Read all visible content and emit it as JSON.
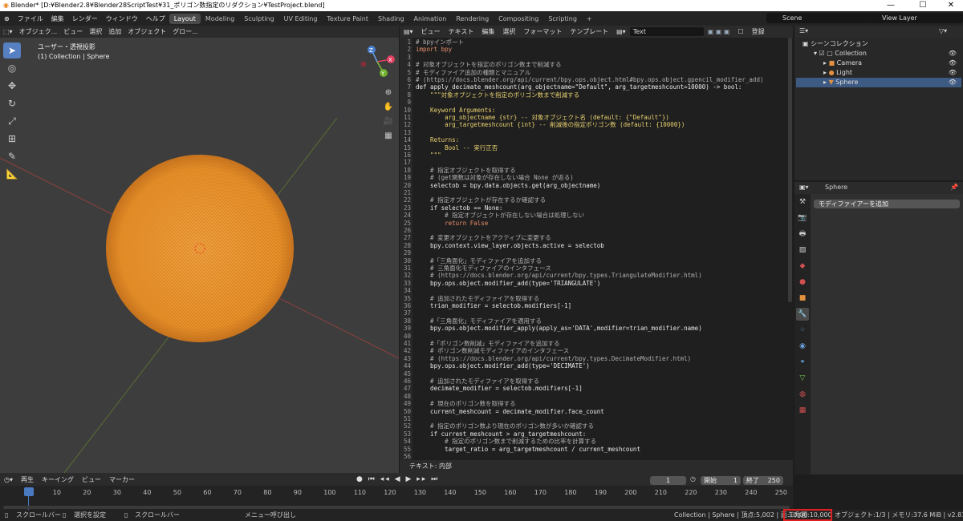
{
  "window": {
    "title": "Blender* [D:¥Blender2.8¥Blender28ScriptTest¥31_ポリゴン数指定のリダクション¥TestProject.blend]",
    "min": "—",
    "max": "☐",
    "close": "✕"
  },
  "menubar": {
    "menus": [
      "ファイル",
      "編集",
      "レンダー",
      "ウィンドウ",
      "ヘルプ"
    ],
    "workspaces": [
      "Layout",
      "Modeling",
      "Sculpting",
      "UV Editing",
      "Texture Paint",
      "Shading",
      "Animation",
      "Rendering",
      "Compositing",
      "Scripting"
    ],
    "active_workspace": "Layout",
    "add_tab": "+",
    "scene": "Scene",
    "view_layer": "View Layer"
  },
  "viewport": {
    "header": [
      "オブジェク...",
      "ビュー",
      "選択",
      "追加",
      "オブジェクト",
      "グロー..."
    ],
    "view_label": "ユーザー・透視投影",
    "collection_label": "(1) Collection | Sphere",
    "gizmo_x": "X",
    "gizmo_y": "Y",
    "gizmo_z": "Z"
  },
  "text_editor": {
    "header": [
      "ビュー",
      "テキスト",
      "編集",
      "選択",
      "フォーマット",
      "テンプレート"
    ],
    "text_name": "Text",
    "register_label": "登録",
    "footer": "テキスト: 内部"
  },
  "code_lines": [
    {
      "n": "1",
      "t": "# bpyインポート",
      "c": "c"
    },
    {
      "n": "2",
      "t": "import bpy",
      "c": "k"
    },
    {
      "n": "3",
      "t": "",
      "c": "t"
    },
    {
      "n": "4",
      "t": "# 対象オブジェクトを指定のポリゴン数まで削減する",
      "c": "c"
    },
    {
      "n": "5",
      "t": "# モディファイア追加の種類とマニュアル",
      "c": "c"
    },
    {
      "n": "6",
      "t": "# (https://docs.blender.org/api/current/bpy.ops.object.html#bpy.ops.object.gpencil_modifier_add)",
      "c": "c"
    },
    {
      "n": "7",
      "t": "def apply_decimate_meshcount(arg_objectname=\"Default\", arg_targetmeshcount=10000) -> bool:",
      "c": "t"
    },
    {
      "n": "8",
      "t": "    \"\"\"対象オブジェクトを指定のポリゴン数まで削減する",
      "c": "d"
    },
    {
      "n": "9",
      "t": "",
      "c": "t"
    },
    {
      "n": "10",
      "t": "    Keyword Arguments:",
      "c": "d"
    },
    {
      "n": "11",
      "t": "        arg_objectname {str} -- 対象オブジェクト名 (default: {\"Default\"})",
      "c": "d"
    },
    {
      "n": "12",
      "t": "        arg_targetmeshcount {int} -- 削減後の指定ポリゴン数 (default: {10000})",
      "c": "d"
    },
    {
      "n": "13",
      "t": "",
      "c": "t"
    },
    {
      "n": "14",
      "t": "    Returns:",
      "c": "d"
    },
    {
      "n": "15",
      "t": "        Bool -- 実行正否",
      "c": "d"
    },
    {
      "n": "16",
      "t": "    \"\"\"",
      "c": "d"
    },
    {
      "n": "17",
      "t": "",
      "c": "t"
    },
    {
      "n": "18",
      "t": "    # 指定オブジェクトを取得する",
      "c": "c"
    },
    {
      "n": "19",
      "t": "    # (get関数は対象が存在しない場合 None が返る)",
      "c": "c"
    },
    {
      "n": "20",
      "t": "    selectob = bpy.data.objects.get(arg_objectname)",
      "c": "t"
    },
    {
      "n": "21",
      "t": "",
      "c": "t"
    },
    {
      "n": "22",
      "t": "    # 指定オブジェクトが存在するか確認する",
      "c": "c"
    },
    {
      "n": "23",
      "t": "    if selectob == None:",
      "c": "t"
    },
    {
      "n": "24",
      "t": "        # 指定オブジェクトが存在しない場合は処理しない",
      "c": "c"
    },
    {
      "n": "25",
      "t": "        return False",
      "c": "k"
    },
    {
      "n": "26",
      "t": "",
      "c": "t"
    },
    {
      "n": "27",
      "t": "    # 変更オブジェクトをアクティブに変更する",
      "c": "c"
    },
    {
      "n": "28",
      "t": "    bpy.context.view_layer.objects.active = selectob",
      "c": "t"
    },
    {
      "n": "29",
      "t": "",
      "c": "t"
    },
    {
      "n": "30",
      "t": "    #「三角面化」モディファイアを追加する",
      "c": "c"
    },
    {
      "n": "31",
      "t": "    # 三角面化モディファイアのインタフェース",
      "c": "c"
    },
    {
      "n": "32",
      "t": "    # (https://docs.blender.org/api/current/bpy.types.TriangulateModifier.html)",
      "c": "c"
    },
    {
      "n": "33",
      "t": "    bpy.ops.object.modifier_add(type='TRIANGULATE')",
      "c": "t"
    },
    {
      "n": "34",
      "t": "",
      "c": "t"
    },
    {
      "n": "35",
      "t": "    # 追加されたモディファイアを取得する",
      "c": "c"
    },
    {
      "n": "36",
      "t": "    trian_modifier = selectob.modifiers[-1]",
      "c": "t"
    },
    {
      "n": "37",
      "t": "",
      "c": "t"
    },
    {
      "n": "38",
      "t": "    #「三角面化」モディファイアを適用する",
      "c": "c"
    },
    {
      "n": "39",
      "t": "    bpy.ops.object.modifier_apply(apply_as='DATA',modifier=trian_modifier.name)",
      "c": "t"
    },
    {
      "n": "40",
      "t": "",
      "c": "t"
    },
    {
      "n": "41",
      "t": "    #「ポリゴン数削減」モディファイアを追加する",
      "c": "c"
    },
    {
      "n": "42",
      "t": "    # ポリゴン数削減モディファイアのインタフェース",
      "c": "c"
    },
    {
      "n": "43",
      "t": "    # (https://docs.blender.org/api/current/bpy.types.DecimateModifier.html)",
      "c": "c"
    },
    {
      "n": "44",
      "t": "    bpy.ops.object.modifier_add(type='DECIMATE')",
      "c": "t"
    },
    {
      "n": "45",
      "t": "",
      "c": "t"
    },
    {
      "n": "46",
      "t": "    # 追加されたモディファイアを取得する",
      "c": "c"
    },
    {
      "n": "47",
      "t": "    decimate_modifier = selectob.modifiers[-1]",
      "c": "t"
    },
    {
      "n": "48",
      "t": "",
      "c": "t"
    },
    {
      "n": "49",
      "t": "    # 現在のポリゴン数を取得する",
      "c": "c"
    },
    {
      "n": "50",
      "t": "    current_meshcount = decimate_modifier.face_count",
      "c": "t"
    },
    {
      "n": "51",
      "t": "",
      "c": "t"
    },
    {
      "n": "52",
      "t": "    # 指定のポリゴン数より現在のポリゴン数が多いか確認する",
      "c": "c"
    },
    {
      "n": "53",
      "t": "    if current_meshcount > arg_targetmeshcount:",
      "c": "t"
    },
    {
      "n": "54",
      "t": "        # 指定のポリゴン数まで削減するための比率を計算する",
      "c": "c"
    },
    {
      "n": "55",
      "t": "        target_ratio = arg_targetmeshcount / current_meshcount",
      "c": "t"
    },
    {
      "n": "56",
      "t": "",
      "c": "t"
    }
  ],
  "outliner": {
    "root": "シーンコレクション",
    "items": [
      {
        "label": "Collection",
        "icon": "collection-icon"
      },
      {
        "label": "Camera",
        "icon": "camera-icon"
      },
      {
        "label": "Light",
        "icon": "light-icon"
      },
      {
        "label": "Sphere",
        "icon": "mesh-icon"
      }
    ]
  },
  "properties": {
    "object_name": "Sphere",
    "add_modifier": "モディファイアーを追加"
  },
  "timeline": {
    "header": [
      "再生",
      "キーイング",
      "ビュー",
      "マーカー"
    ],
    "current_frame": "1",
    "start_label": "開始",
    "start": "1",
    "end_label": "終了",
    "end": "250",
    "frames": [
      "1",
      "10",
      "20",
      "30",
      "40",
      "50",
      "60",
      "70",
      "80",
      "90",
      "100",
      "110",
      "120",
      "130",
      "140",
      "150",
      "160",
      "170",
      "180",
      "190",
      "200",
      "210",
      "220",
      "230",
      "240",
      "250"
    ]
  },
  "statusbar": {
    "left": [
      "スクロールバー",
      "選択を設定",
      "スクロールバー",
      "メニュー呼び出し"
    ],
    "stats_a": "Collection | Sphere | 頂点:5,002 | 面:10,00",
    "stats_tri": "三角面:10,000",
    "stats_b": "オブジェクト:1/3 | メモリ:37.6 MiB | v2.81.16"
  }
}
